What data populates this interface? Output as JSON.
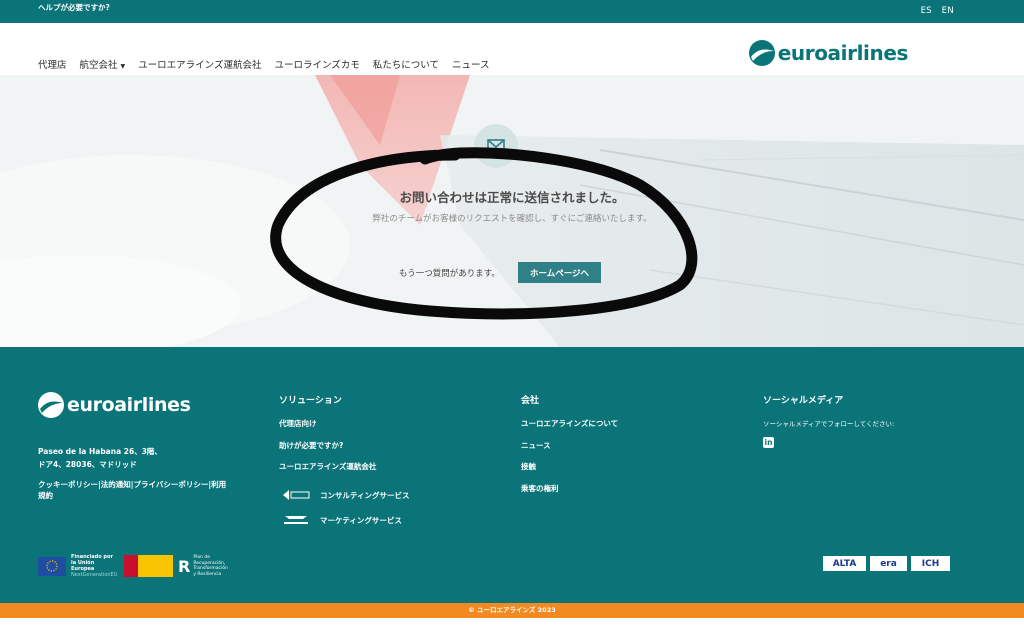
{
  "topbar": {
    "help_text": "ヘルプが必要ですか?",
    "languages": [
      "ES",
      "EN"
    ]
  },
  "nav": {
    "items": [
      {
        "label": "代理店"
      },
      {
        "label": "航空会社",
        "has_dropdown": true
      },
      {
        "label": "ユーロエアラインズ運航会社"
      },
      {
        "label": "ユーロラインズカモ"
      },
      {
        "label": "私たちについて"
      },
      {
        "label": "ニュース"
      }
    ],
    "logo_text": "euroairlines"
  },
  "hero": {
    "icon": "mail-icon",
    "title": "お問い合わせは正常に送信されました。",
    "subtitle": "弊社のチームがお客様のリクエストを確認し、すぐにご連絡いたします。",
    "question": "もう一つ質問があります。",
    "home_button": "ホームページへ"
  },
  "footer": {
    "logo_text": "euroairlines",
    "address_line1": "Paseo de la Habana 26、3階、",
    "address_line2": "ドア4、28036、マドリッド",
    "legal_links": "クッキーポリシー|法的通知|プライバシーポリシー|利用規約",
    "solutions": {
      "heading": "ソリューション",
      "items": [
        "代理店向け",
        "助けが必要ですか?",
        "ユーロエアラインズ運航会社"
      ],
      "partners": [
        {
          "label": "コンサルティングサービス",
          "icon": "consulting-partner-logo"
        },
        {
          "label": "マーケティングサービス",
          "icon": "flg-aviation-logo"
        }
      ]
    },
    "company": {
      "heading": "会社",
      "items": [
        "ユーロエアラインズについて",
        "ニュース",
        "接触",
        "乗客の権利"
      ]
    },
    "social": {
      "heading": "ソーシャルメディア",
      "note": "ソーシャルメディアでフォローしてください:",
      "linkedin_label": "in"
    },
    "funding": {
      "eu_line1": "Financiado por",
      "eu_line2": "la Unión Europea",
      "eu_line3": "NextGenerationEU",
      "plan_text": "Plan de Recuperación, Transformación y Resiliencia"
    },
    "associations": [
      "ALTA",
      "era",
      "ICH"
    ],
    "copyright": "© ユーロエアラインズ 2023"
  },
  "colors": {
    "brand_teal": "#0a7478",
    "button_teal": "#2f8187",
    "accent_orange": "#f28a24"
  }
}
